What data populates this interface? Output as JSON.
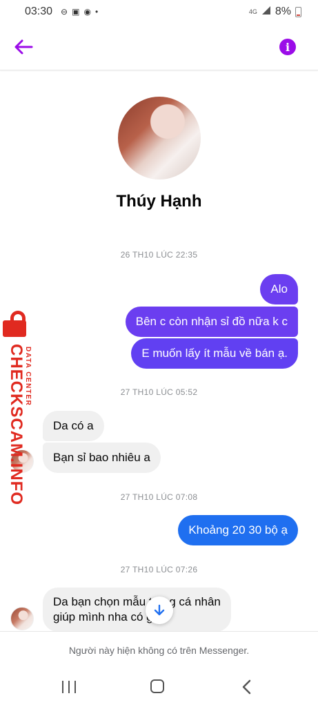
{
  "status_bar": {
    "time": "03:30",
    "network": "4G",
    "battery": "8%"
  },
  "contact": {
    "name": "Thúy Hạnh"
  },
  "messages": {
    "ts1": "26 TH10 LÚC 22:35",
    "m1": "Alo",
    "m2": "Bên c còn nhận sỉ đồ nữa k c",
    "m3": "E muốn lấy ít mẫu về bán ạ.",
    "ts2": "27 TH10 LÚC 05:52",
    "m4": "Da có a",
    "m5": "Bạn sỉ bao nhiêu a",
    "ts3": "27 TH10 LÚC 07:08",
    "m6": "Khoảng 20 30 bộ ạ",
    "ts4": "27 TH10 LÚC 07:26",
    "m7_line1": "Da bạn chọn mẫu trong cá nhân",
    "m7_line2": "giúp mình nha có gì."
  },
  "watermark": {
    "small": "DATA CENTER",
    "big": "CHECKSCAM.INFO"
  },
  "footer": {
    "notice": "Người này hiện không có trên Messenger."
  },
  "colors": {
    "accent": "#9b0ce8",
    "bubble_purple": "#6b3ef0",
    "bubble_blue": "#1f6ff0",
    "incoming_bg": "#f0f0f0",
    "watermark": "#e02a20"
  }
}
